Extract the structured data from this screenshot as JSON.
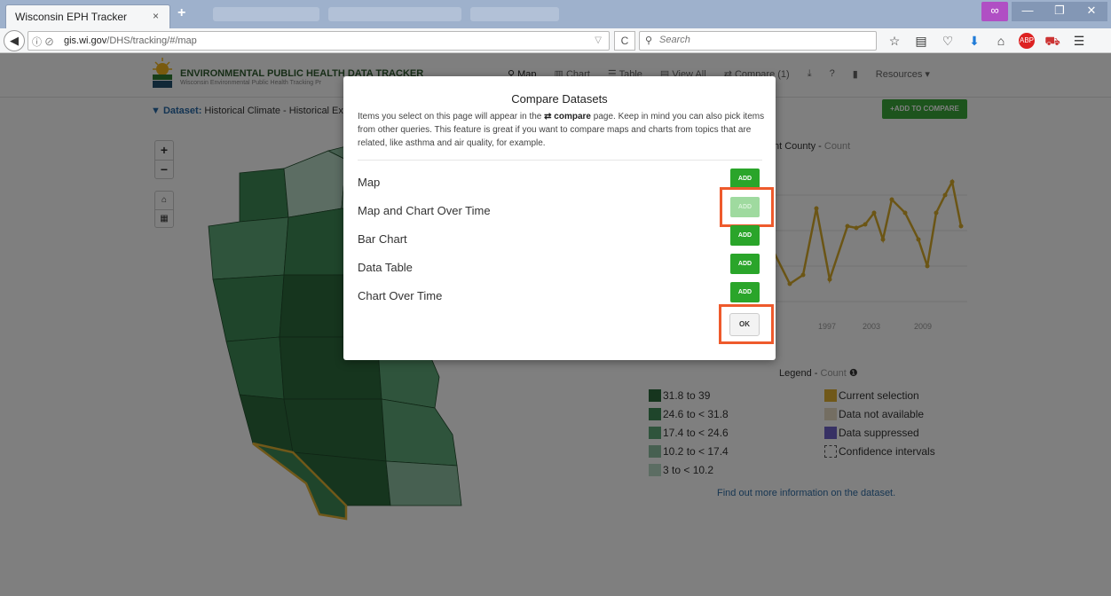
{
  "browser": {
    "tab_title": "Wisconsin EPH Tracker",
    "tab_close": "×",
    "new_tab": "+",
    "url_domain": "gis.wi.gov",
    "url_path": "/DHS/tracking/#/map",
    "search_placeholder": "Search"
  },
  "site": {
    "title": "ENVIRONMENTAL PUBLIC HEALTH DATA TRACKER",
    "subtitle": "Wisconsin Environmental Public Health Tracking Pr",
    "nav": {
      "map": "Map",
      "chart": "Chart",
      "table": "Table",
      "view_all": "View All",
      "compare": "Compare (1)",
      "resources": "Resources"
    },
    "dataset_label": "Dataset:",
    "dataset_value": "Historical Climate - Historical Extre",
    "add_to_compare": "ADD TO COMPARE"
  },
  "map": {
    "zoom_in": "+",
    "zoom_out": "−",
    "colors": {
      "bin1": "#2d6a3c",
      "bin2": "#3f8b57",
      "bin3": "#5fa878",
      "bin4": "#8ec0a2",
      "bin5": "#b9dac6",
      "selection": "#e0b032"
    }
  },
  "chart": {
    "title_name": "nt County",
    "title_measure": "Count",
    "x_ticks": [
      "1997",
      "2003",
      "2009"
    ],
    "line_color": "#d7ab2a"
  },
  "legend": {
    "title": "Legend",
    "measure": "Count",
    "bins": [
      {
        "label": "31.8 to 39",
        "color": "#2d6a3c"
      },
      {
        "label": "24.6 to < 31.8",
        "color": "#3f8b57"
      },
      {
        "label": "17.4 to < 24.6",
        "color": "#5fa878"
      },
      {
        "label": "10.2 to < 17.4",
        "color": "#8ec0a2"
      },
      {
        "label": "3 to < 10.2",
        "color": "#b9dac6"
      }
    ],
    "other": [
      {
        "label": "Current selection",
        "color": "#e0b032"
      },
      {
        "label": "Data not available",
        "color": "#e8dcc4"
      },
      {
        "label": "Data suppressed",
        "color": "#6f63c9"
      },
      {
        "label": "Confidence intervals",
        "color": "none"
      }
    ],
    "find_out": "Find out more information on the dataset."
  },
  "modal": {
    "title": "Compare Datasets",
    "desc_pre": "Items you select on this page will appear in the",
    "desc_link": "compare",
    "desc_post": "page. Keep in mind you can also pick items from other queries. This feature is great if you want to compare maps and charts from topics that are related, like asthma and air quality, for example.",
    "options": [
      {
        "label": "Map",
        "button": "ADD"
      },
      {
        "label": "Map and Chart Over Time",
        "button": "ADD"
      },
      {
        "label": "Bar Chart",
        "button": "ADD"
      },
      {
        "label": "Data Table",
        "button": "ADD"
      },
      {
        "label": "Chart Over Time",
        "button": "ADD"
      }
    ],
    "ok": "OK",
    "highlight_color": "#ee5a2c"
  }
}
